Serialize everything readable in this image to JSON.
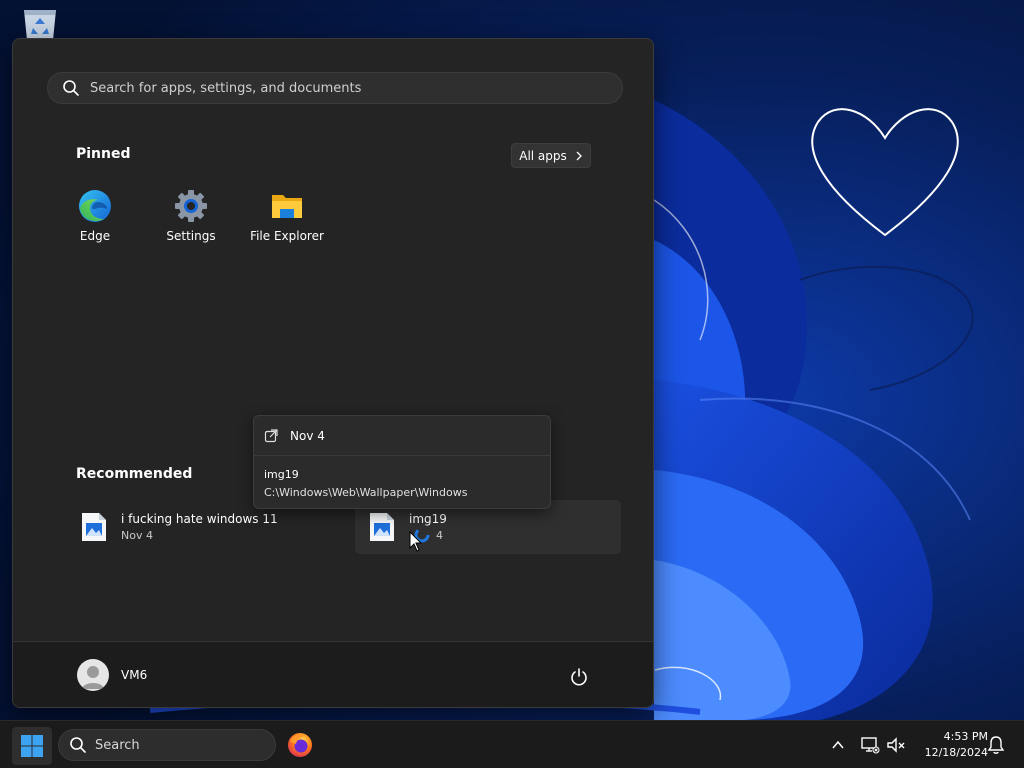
{
  "start_menu": {
    "search_placeholder": "Search for apps, settings, and documents",
    "pinned_title": "Pinned",
    "all_apps_label": "All apps",
    "pinned": [
      {
        "label": "Edge",
        "icon": "edge-icon"
      },
      {
        "label": "Settings",
        "icon": "settings-gear-icon"
      },
      {
        "label": "File Explorer",
        "icon": "folder-icon"
      }
    ],
    "recommended_title": "Recommended",
    "recommended": [
      {
        "name": "i fucking hate windows 11",
        "date": "Nov 4",
        "icon": "image-file-icon"
      },
      {
        "name": "img19",
        "date": "4",
        "icon": "image-file-icon"
      }
    ],
    "tooltip": {
      "date": "Nov 4",
      "name": "img19",
      "path": "C:\\Windows\\Web\\Wallpaper\\Windows"
    },
    "user_name": "VM6"
  },
  "taskbar": {
    "search_label": "Search",
    "time": "4:53 PM",
    "date": "12/18/2024"
  },
  "colors": {
    "menu_bg": "#242424",
    "footer_bg": "#1c1c1c",
    "taskbar_bg": "#1b1b1b",
    "accent": "#3a8ee6"
  }
}
